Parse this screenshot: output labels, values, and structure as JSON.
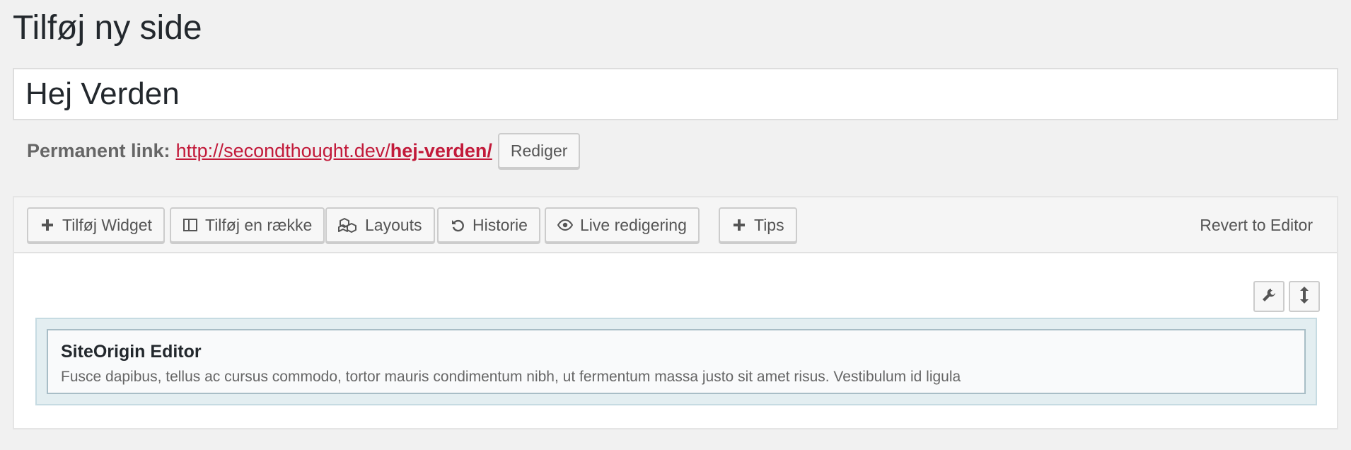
{
  "page": {
    "title": "Tilføj ny side"
  },
  "post": {
    "title_value": "Hej Verden"
  },
  "permalink": {
    "label": "Permanent link:",
    "url_base": "http://secondthought.dev/",
    "url_slug": "hej-verden/",
    "edit_label": "Rediger"
  },
  "toolbar": {
    "add_widget": "Tilføj Widget",
    "add_row": "Tilføj en række",
    "layouts": "Layouts",
    "history": "Historie",
    "live_edit": "Live redigering",
    "tips": "Tips",
    "revert": "Revert to Editor"
  },
  "icons": {
    "add_widget": "plus-icon",
    "add_row": "columns-icon",
    "layouts": "cubes-icon",
    "history": "undo-icon",
    "live_edit": "eye-icon",
    "tips": "plus-icon",
    "row_settings": "wrench-icon",
    "row_move": "vertical-arrows-icon"
  },
  "builder": {
    "widget_title": "SiteOrigin Editor",
    "widget_description": "Fusce dapibus, tellus ac cursus commodo, tortor mauris condimentum nibh, ut fermentum massa justo sit amet risus. Vestibulum id ligula"
  },
  "colors": {
    "link": "#c21a3a",
    "row_background": "#e3eef1",
    "page_background": "#f1f1f1"
  }
}
